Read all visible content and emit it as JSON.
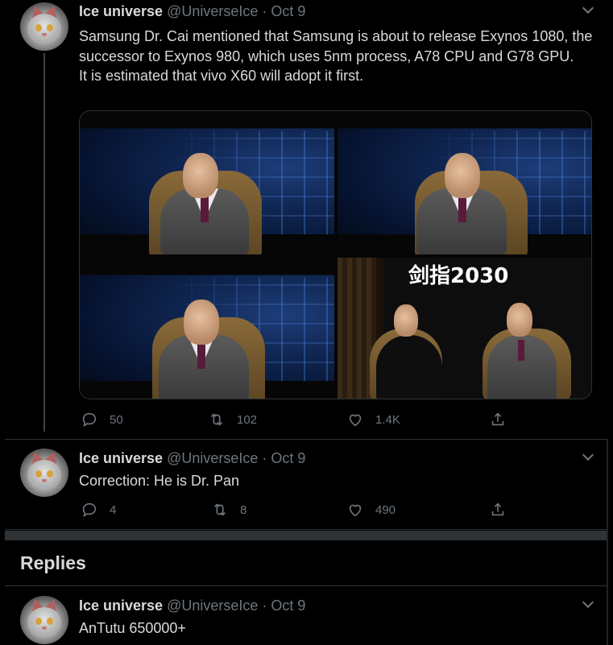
{
  "tweets": [
    {
      "name": "Ice universe",
      "handle": "@UniverseIce",
      "dot": "·",
      "date": "Oct 9",
      "text": "Samsung Dr. Cai mentioned that Samsung is about to release Exynos 1080, the successor to Exynos 980, which uses 5nm process, A78 CPU and G78 GPU.\nIt is estimated that vivo X60 will adopt it first.",
      "media_overlay_text": "剑指2030",
      "replies": "50",
      "retweets": "102",
      "likes": "1.4K"
    },
    {
      "name": "Ice universe",
      "handle": "@UniverseIce",
      "dot": "·",
      "date": "Oct 9",
      "text": "Correction: He is Dr. Pan",
      "replies": "4",
      "retweets": "8",
      "likes": "490"
    },
    {
      "name": "Ice universe",
      "handle": "@UniverseIce",
      "dot": "·",
      "date": "Oct 9",
      "text": "AnTutu 650000+"
    }
  ],
  "section": {
    "replies_title": "Replies"
  },
  "icons": {
    "reply": "reply-icon",
    "retweet": "retweet-icon",
    "like": "heart-icon",
    "share": "share-icon",
    "more": "chevron-down-icon"
  },
  "colors": {
    "background": "#000000",
    "text": "#d9d9d9",
    "muted": "#6e767d",
    "divider": "#2f3336"
  }
}
